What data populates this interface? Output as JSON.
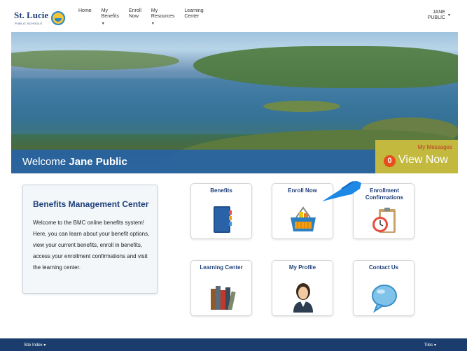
{
  "header": {
    "logo_name": "St. Lucie",
    "logo_sub": "PUBLIC SCHOOLS",
    "nav": [
      {
        "line1": "Home",
        "line2": "",
        "caret": false
      },
      {
        "line1": "My",
        "line2": "Benefits",
        "caret": true
      },
      {
        "line1": "Enroll",
        "line2": "Now",
        "caret": false
      },
      {
        "line1": "My",
        "line2": "Resources",
        "caret": true
      },
      {
        "line1": "Learning",
        "line2": "Center",
        "caret": false
      }
    ],
    "user_first": "JANE",
    "user_last": "PUBLIC"
  },
  "hero": {
    "welcome_prefix": "Welcome",
    "welcome_name": "Jane Public",
    "messages_title": "My Messages",
    "messages_count": "0",
    "messages_link": "View Now"
  },
  "info": {
    "title": "Benefits Management Center",
    "body": "Welcome to the BMC online benefits system! Here, you can learn about your benefit options, view your current benefits, enroll in benefits, access your enrollment confirmations and visit the learning center."
  },
  "tiles": [
    {
      "label": "Benefits",
      "icon": "binder-icon"
    },
    {
      "label": "Enroll Now",
      "icon": "basket-icon"
    },
    {
      "label": "Enrollment Confirmations",
      "icon": "clipboard-clock-icon"
    },
    {
      "label": "Learning Center",
      "icon": "books-icon"
    },
    {
      "label": "My Profile",
      "icon": "user-profile-icon"
    },
    {
      "label": "Contact Us",
      "icon": "speech-bubble-icon"
    }
  ],
  "footer": {
    "left": "Site Index",
    "right": "Tiles"
  },
  "colors": {
    "brand_navy": "#1e3f7a",
    "welcome_bar": "#2662aa",
    "messages_bg": "#c2b93e",
    "badge": "#e84e1b",
    "footer": "#1a3d6e"
  }
}
